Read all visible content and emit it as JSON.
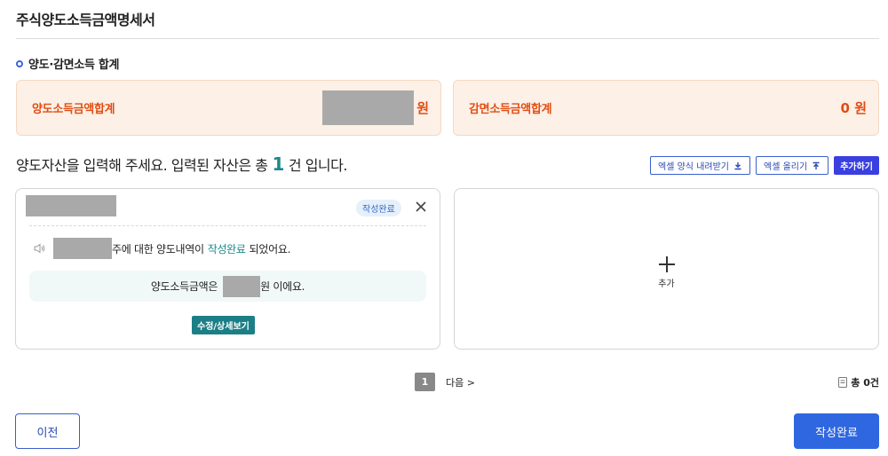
{
  "page": {
    "title": "주식양도소득금액명세서"
  },
  "summary_section": {
    "title": "양도·감면소득 합계",
    "transfer_total": {
      "label": "양도소득금액합계",
      "unit": "원"
    },
    "reduction_total": {
      "label": "감면소득금액합계",
      "value": "0 원"
    }
  },
  "asset_section": {
    "title_prefix": "양도자산을 입력해 주세요. 입력된 자산은 총",
    "count": "1",
    "title_suffix": "건 입니다.",
    "buttons": {
      "download": "엑셀 양식 내려받기",
      "upload": "엑셀 올리기",
      "add": "추가하기"
    }
  },
  "asset_card": {
    "status": "작성완료",
    "notice_prefix": "주에 대한 양도내역이",
    "notice_accent": "작성완료",
    "notice_suffix": "되었어요.",
    "amount_prefix": "양도소득금액은",
    "amount_suffix": "원 이에요.",
    "edit_label": "수정/상세보기"
  },
  "add_card": {
    "label": "추가"
  },
  "pagination": {
    "current": "1",
    "next_label": "다음 >"
  },
  "total": {
    "label": "총 0건"
  },
  "footer": {
    "prev_label": "이전",
    "complete_label": "작성완료"
  },
  "colors": {
    "accent_orange": "#e04e14",
    "teal": "#1b8a8a",
    "primary_blue": "#2f67e0"
  }
}
